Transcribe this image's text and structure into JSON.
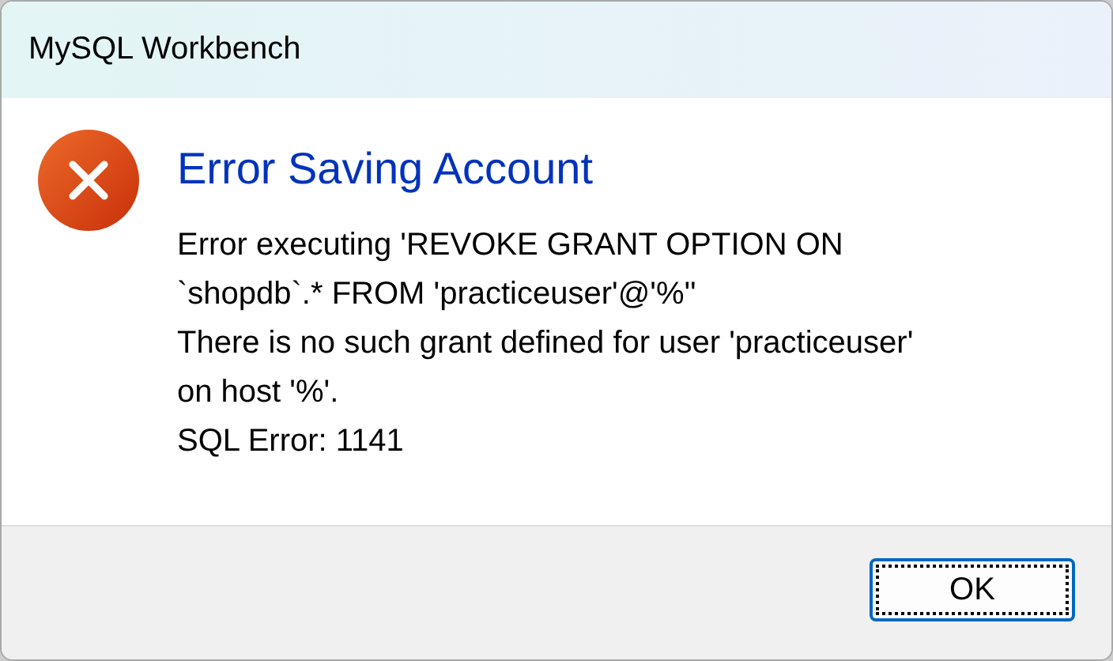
{
  "window": {
    "title": "MySQL Workbench"
  },
  "dialog": {
    "heading": "Error Saving Account",
    "message": "Error executing 'REVOKE GRANT OPTION ON\n`shopdb`.* FROM 'practiceuser'@'%''\nThere is no such grant defined for user 'practiceuser'\non host '%'.\nSQL Error: 1141"
  },
  "buttons": [
    {
      "label": "OK",
      "focused": true
    }
  ]
}
